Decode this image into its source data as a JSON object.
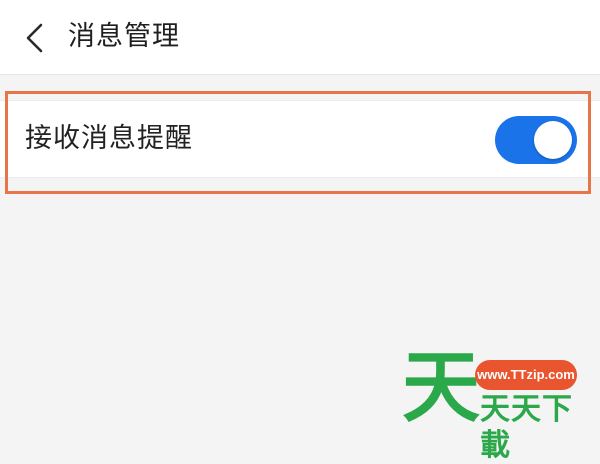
{
  "header": {
    "title": "消息管理",
    "back_icon": "chevron-left-icon"
  },
  "settings": {
    "items": [
      {
        "label": "接收消息提醒",
        "toggle_on": true
      }
    ]
  },
  "watermark": {
    "big_char": "天",
    "url": "www.TTzip.com",
    "text": "天天下載"
  },
  "colors": {
    "toggle_on": "#1a73e8",
    "highlight_border": "#e8754a",
    "watermark_green": "#2aa84a",
    "watermark_pill": "#e8552e",
    "page_background": "#f4f4f4"
  }
}
